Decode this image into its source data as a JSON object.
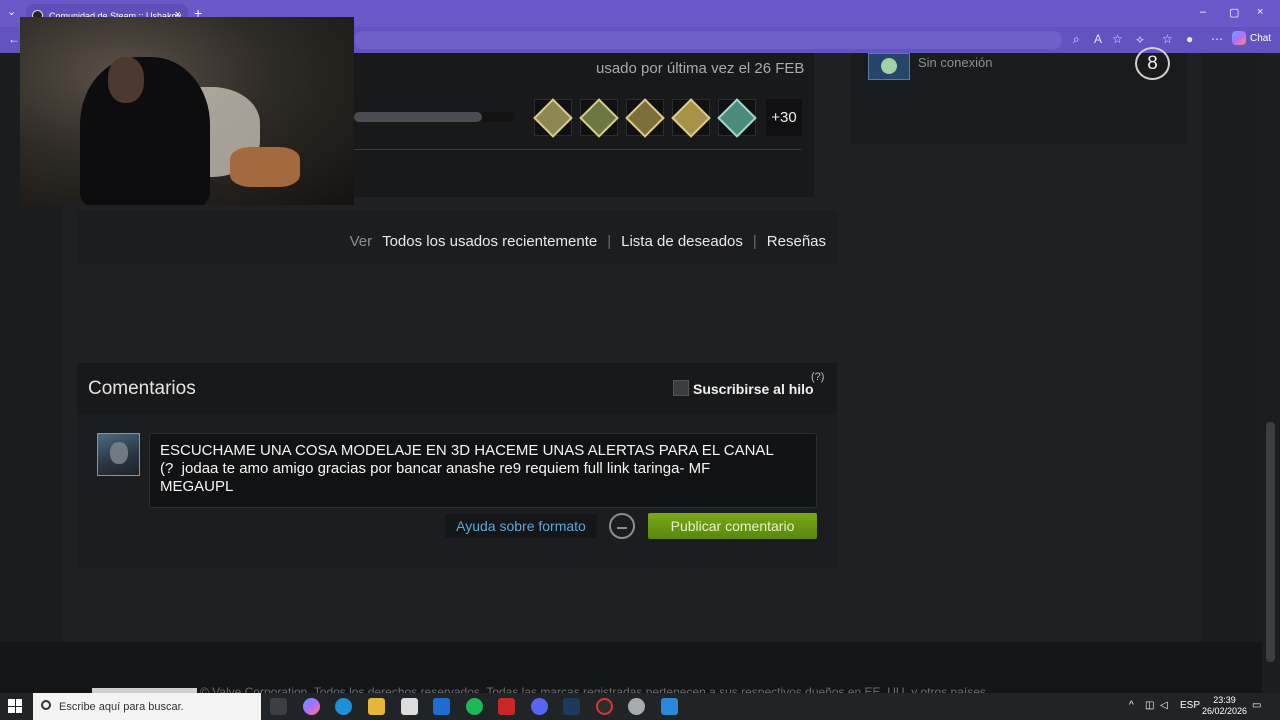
{
  "browser": {
    "tab_title": "Comunidad de Steam :: Ushakov",
    "tab_close": "×",
    "new_tab": "+",
    "chat_label": "Chat",
    "min": "‒",
    "max": "▢",
    "close": "×"
  },
  "profile": {
    "last_played": "usado por última vez el 26 FEB",
    "achievements_more": "+30",
    "achievement_progress": 0.8
  },
  "links": {
    "prefix": "Ver",
    "recent": "Todos los usados recientemente",
    "wishlist": "Lista de deseados",
    "reviews": "Reseñas",
    "separator": "|"
  },
  "friend": {
    "status": "Sin conexión",
    "level": "8"
  },
  "comments": {
    "title": "Comentarios",
    "subscribe": "Suscribirse al hilo",
    "help_mark": "(?)",
    "input_text": "ESCUCHAME UNA COSA MODELAJE EN 3D HACEME UNAS ALERTAS PARA EL CANAL\n(?  jodaa te amo amigo gracias por bancar anashe re9 requiem full link taringa- MF\nMEGAUPL",
    "format_help": "Ayuda sobre formato",
    "publish": "Publicar comentario"
  },
  "footer": {
    "text": "© Valve Corporation. Todos los derechos reservados. Todas las marcas registradas pertenecen a sus respectivos dueños en EE. UU. y otros países."
  },
  "taskbar": {
    "search_placeholder": "Escribe aquí para buscar.",
    "lang": "ESP",
    "time": "23:39",
    "date": "26/02/2026",
    "tray_chevron": "^"
  },
  "colors": {
    "browser_accent": "#6b59c9",
    "publish_green": "#79a818",
    "link_blue": "#5ea7d8"
  }
}
